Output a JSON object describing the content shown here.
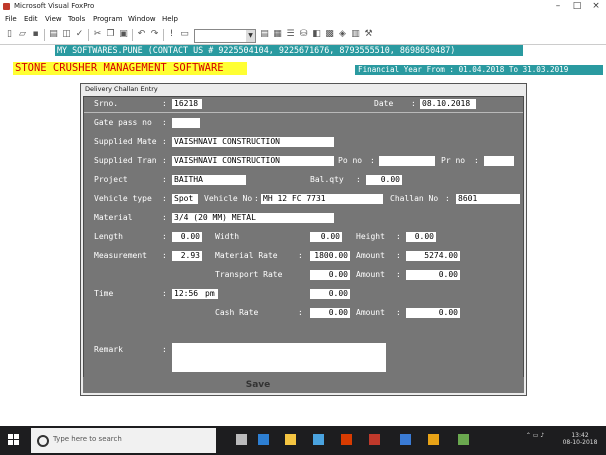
{
  "window": {
    "title": "Microsoft Visual FoxPro"
  },
  "menu": [
    "File",
    "Edit",
    "View",
    "Tools",
    "Program",
    "Window",
    "Help"
  ],
  "header": {
    "contact": "MY SOFTWARES.PUNE (CONTACT US # 9225504104, 9225671676, 8793555510, 8698650487)",
    "app_name": "STONE CRUSHER MANAGEMENT SOFTWARE",
    "financial_year": "Financial Year From : 01.04.2018 To 31.03.2019"
  },
  "dialog": {
    "title": "Delivery Challan Entry",
    "labels": {
      "srno": "Srno.",
      "date": "Date",
      "gate_pass": "Gate pass no",
      "supplied_mate": "Supplied Mate",
      "supplied_tran": "Supplied Tran",
      "po_no": "Po no",
      "pr_no": "Pr no",
      "project": "Project",
      "bal_qty": "Bal.qty",
      "vehicle_type": "Vehicle type",
      "vehicle_no": "Vehicle No",
      "challan_no": "Challan No",
      "material": "Material",
      "length": "Length",
      "width": "Width",
      "height": "Height",
      "measurement": "Measurement",
      "material_rate": "Material Rate",
      "amount": "Amount",
      "transport_rate": "Transport Rate",
      "time": "Time",
      "cash_rate": "Cash Rate",
      "remark": "Remark"
    },
    "values": {
      "srno": "16218",
      "date": "08.10.2018",
      "gate_pass": "",
      "supplied_mate": "VAISHNAVI CONSTRUCTION",
      "supplied_tran": "VAISHNAVI CONSTRUCTION",
      "po_no": "",
      "pr_no": "",
      "project": "BAITHA",
      "bal_qty": "0.00",
      "vehicle_type": "Spot",
      "vehicle_no": "MH 12 FC 7731",
      "challan_no": "8601",
      "material": "3/4 (20 MM) METAL",
      "length": "0.00",
      "width": "0.00",
      "height": "0.00",
      "measurement": "2.93",
      "material_rate": "1800.00",
      "material_amount": "5274.00",
      "transport_rate": "0.00",
      "transport_amount": "0.00",
      "time": "12:56",
      "time_suffix": "pm",
      "time_extra": "0.00",
      "cash_rate": "0.00",
      "cash_amount": "0.00",
      "remark": ""
    },
    "save_label": "Save"
  },
  "taskbar": {
    "search_placeholder": "Type here to search",
    "time": "13:42",
    "date": "08-10-2018"
  }
}
